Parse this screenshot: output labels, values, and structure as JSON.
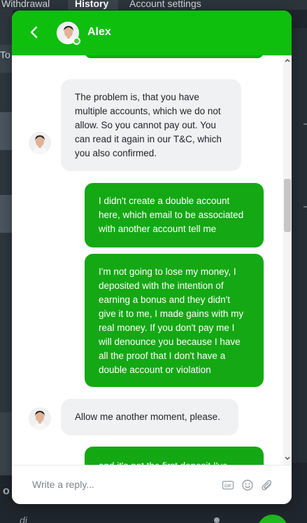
{
  "background": {
    "tabs": [
      "Withdrawal",
      "History",
      "Account settings"
    ],
    "side_label": "To",
    "bottom_char": "o",
    "bottom_text": "di"
  },
  "chat": {
    "agent_name": "Alex",
    "colors": {
      "header": "#0ebf0e",
      "user_bubble": "#14a814",
      "agent_bubble": "#f0f1f2"
    },
    "messages": [
      {
        "sender": "user",
        "lines": []
      },
      {
        "sender": "agent",
        "lines": [
          "The problem is, that you have",
          "multiple accounts, which we do not",
          "allow. So you cannot pay out. You",
          "can read it again in our T&C, which",
          "you also confirmed."
        ]
      },
      {
        "sender": "user",
        "lines": [
          "I didn't create a double account",
          "here, which email to be associated",
          "with another account tell me"
        ]
      },
      {
        "sender": "user",
        "lines": [
          "I'm not going to lose my money, I",
          "deposited with the intention of",
          "earning a bonus and they didn't",
          "give it to me, I made gains with my",
          "real money. If you don't pay me I",
          "will denounce you because I have",
          "all the proof that I don't have a",
          "double account or violation"
        ]
      },
      {
        "sender": "agent",
        "lines": [
          "Allow me another moment, please."
        ]
      },
      {
        "sender": "user",
        "lines": [
          "and it's not the first deposit I've"
        ]
      }
    ],
    "composer": {
      "placeholder": "Write a reply...",
      "gif_label": "GIF"
    }
  }
}
